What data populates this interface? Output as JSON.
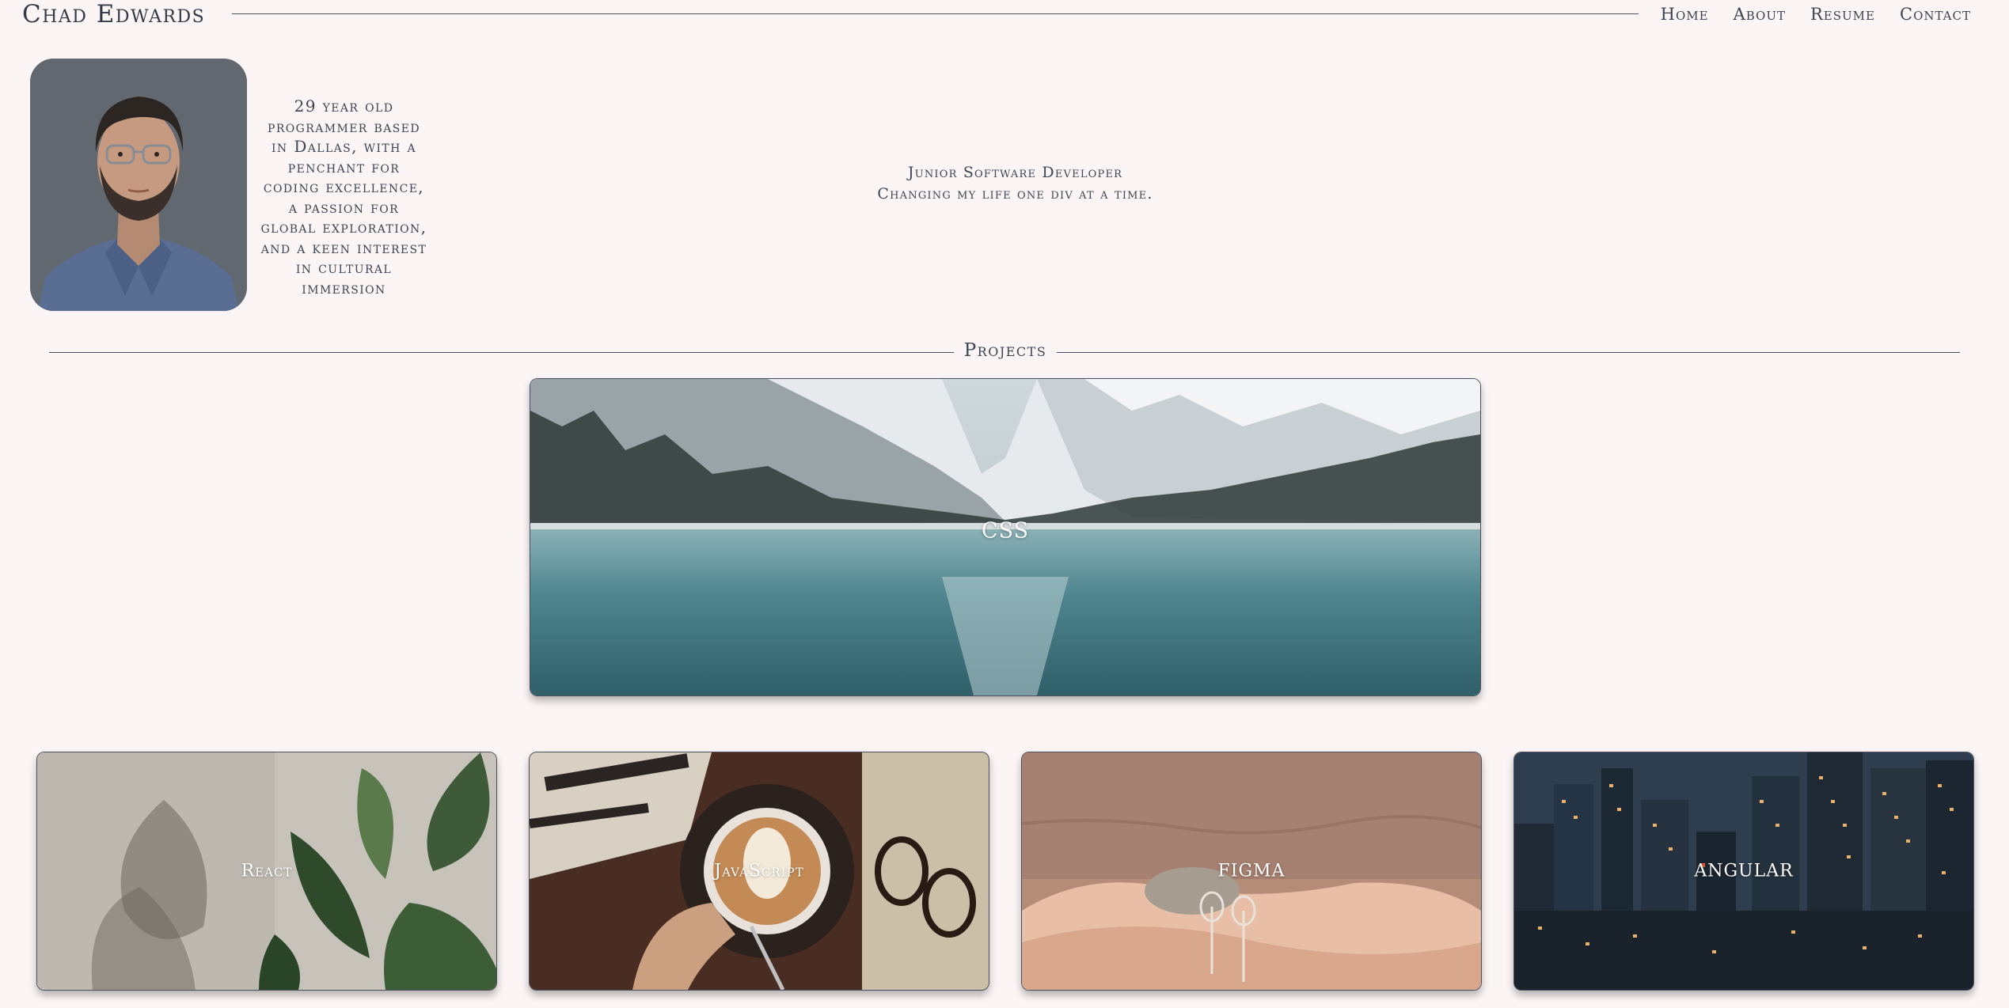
{
  "header": {
    "site_title": "Chad Edwards",
    "nav": [
      {
        "label": "Home"
      },
      {
        "label": "About"
      },
      {
        "label": "Resume"
      },
      {
        "label": "Contact"
      }
    ]
  },
  "profile": {
    "bio_lines": [
      "29 year old",
      "programmer based",
      "in Dallas, with a",
      "penchant for",
      "coding excellence,",
      "a passion for",
      "global exploration,",
      "and a keen interest",
      "in cultural",
      "immersion"
    ],
    "tagline_lines": [
      "Junior Software Developer",
      "Changing my life one div at a time."
    ]
  },
  "projects": {
    "heading": "Projects",
    "featured": {
      "label": "CSS",
      "image": "mountain-lake"
    },
    "cards": [
      {
        "label": "React",
        "image": "plant-leaves"
      },
      {
        "label": "JavaScript",
        "image": "latte-coffee"
      },
      {
        "label": "FIGMA",
        "image": "beach-picnic"
      },
      {
        "label": "ANGULAR",
        "image": "city-night"
      }
    ]
  },
  "colors": {
    "background": "#fbf5f5",
    "text": "#3e4552",
    "rule": "#4a5060",
    "card_label": "#ffffff"
  }
}
